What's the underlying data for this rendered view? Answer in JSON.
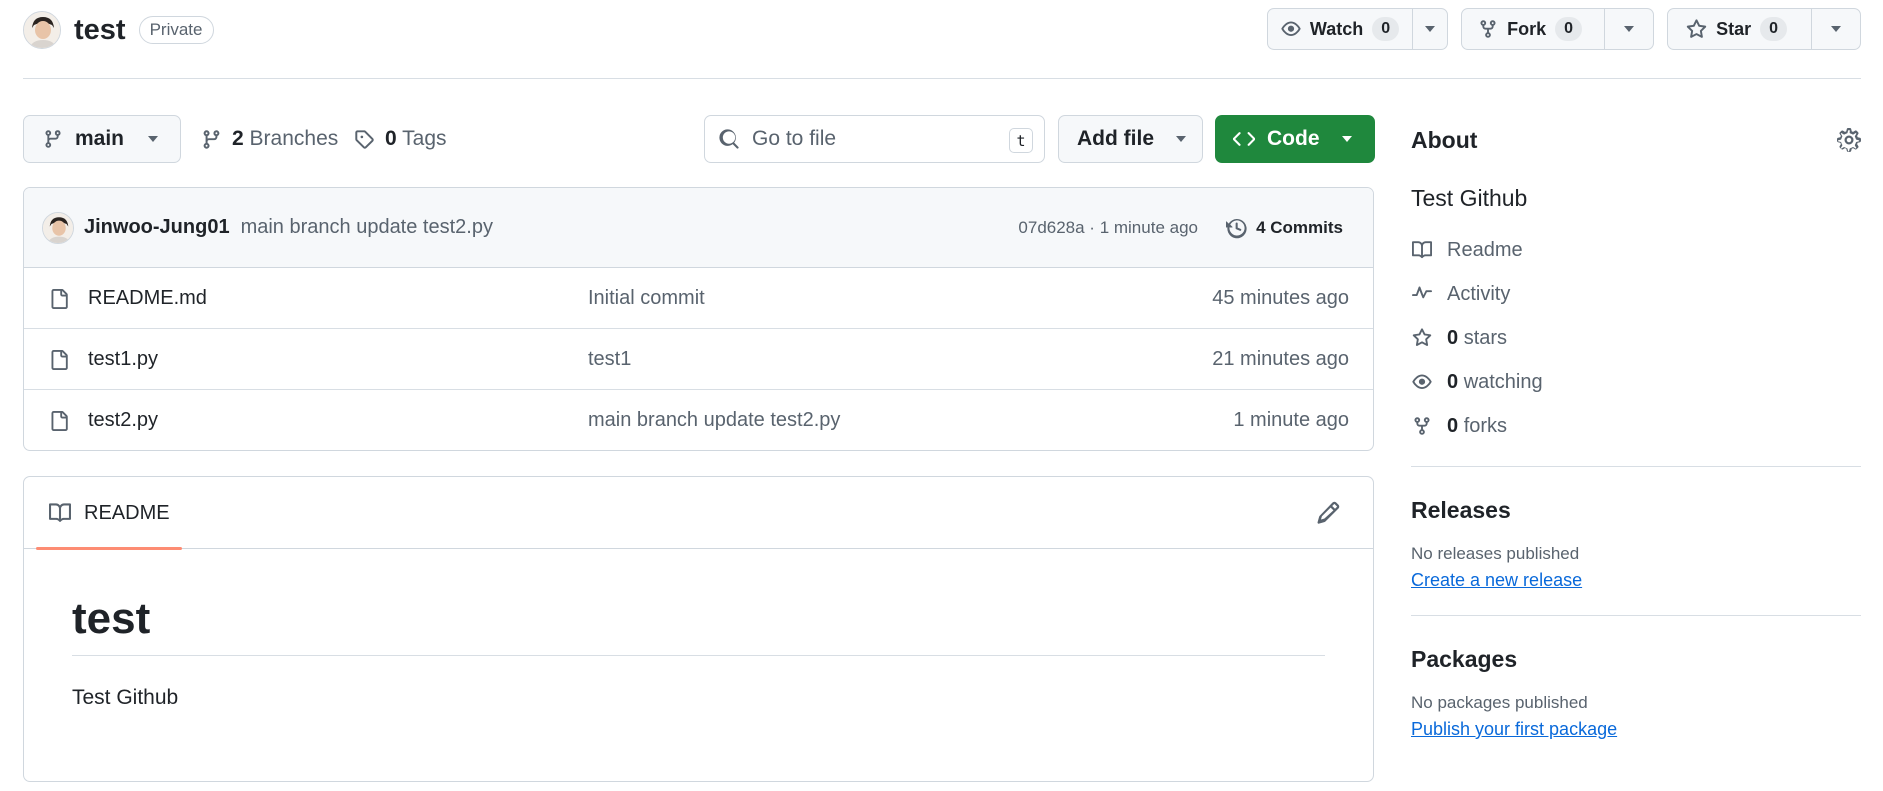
{
  "repo": {
    "name": "test",
    "visibility": "Private"
  },
  "actions": {
    "watch_label": "Watch",
    "watch_count": "0",
    "fork_label": "Fork",
    "fork_count": "0",
    "star_label": "Star",
    "star_count": "0"
  },
  "toolbar": {
    "branch": "main",
    "branches_count": "2",
    "branches_label": "Branches",
    "tags_count": "0",
    "tags_label": "Tags",
    "search_placeholder": "Go to file",
    "search_shortcut": "t",
    "add_file_label": "Add file",
    "code_label": "Code"
  },
  "latest_commit": {
    "author": "Jinwoo-Jung01",
    "message": "main branch update test2.py",
    "hash_time": "07d628a · 1 minute ago",
    "commits_label": "4 Commits"
  },
  "files": [
    {
      "icon": "file-icon",
      "name": "README.md",
      "message": "Initial commit",
      "time": "45 minutes ago"
    },
    {
      "icon": "file-icon",
      "name": "test1.py",
      "message": "test1",
      "time": "21 minutes ago"
    },
    {
      "icon": "file-icon",
      "name": "test2.py",
      "message": "main branch update test2.py",
      "time": "1 minute ago"
    }
  ],
  "readme": {
    "tab_label": "README",
    "heading": "test",
    "body": "Test Github"
  },
  "about": {
    "title": "About",
    "description": "Test Github",
    "items": [
      {
        "icon": "book-icon",
        "count": "",
        "label": "Readme"
      },
      {
        "icon": "pulse-icon",
        "count": "",
        "label": "Activity"
      },
      {
        "icon": "star-icon",
        "count": "0",
        "label": "stars"
      },
      {
        "icon": "eye-icon",
        "count": "0",
        "label": "watching"
      },
      {
        "icon": "fork-icon",
        "count": "0",
        "label": "forks"
      }
    ]
  },
  "releases": {
    "title": "Releases",
    "empty_text": "No releases published",
    "link": "Create a new release"
  },
  "packages": {
    "title": "Packages",
    "empty_text": "No packages published",
    "link": "Publish your first package"
  },
  "colors": {
    "accent_green": "#1f883d",
    "link_blue": "#0969da",
    "tab_underline": "#fd8c73"
  }
}
